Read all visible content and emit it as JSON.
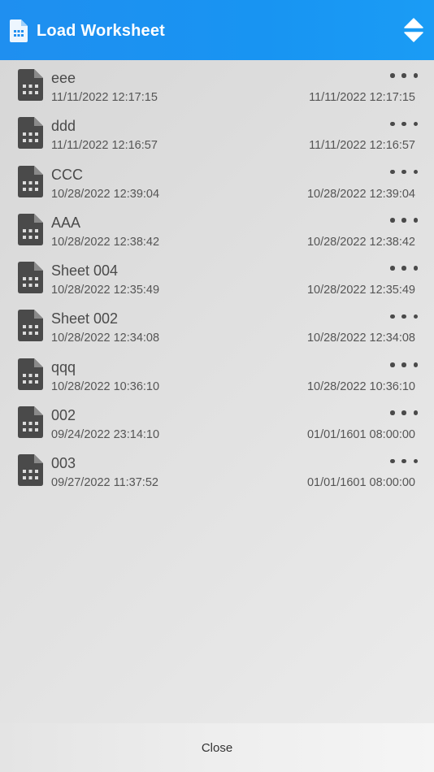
{
  "header": {
    "title": "Load Worksheet",
    "icon": "spreadsheet-file-icon",
    "sort_icon": "sort-up-down-icon"
  },
  "colors": {
    "header_bg": "#1f8ff0",
    "icon_dark": "#4a4a4a",
    "text_primary": "#4a4a4a",
    "text_secondary": "#555555"
  },
  "worksheets": [
    {
      "name": "eee",
      "created": "11/11/2022 12:17:15",
      "modified": "11/11/2022 12:17:15"
    },
    {
      "name": "ddd",
      "created": "11/11/2022 12:16:57",
      "modified": "11/11/2022 12:16:57"
    },
    {
      "name": "CCC",
      "created": "10/28/2022 12:39:04",
      "modified": "10/28/2022 12:39:04"
    },
    {
      "name": "AAA",
      "created": "10/28/2022 12:38:42",
      "modified": "10/28/2022 12:38:42"
    },
    {
      "name": "Sheet 004",
      "created": "10/28/2022 12:35:49",
      "modified": "10/28/2022 12:35:49"
    },
    {
      "name": "Sheet 002",
      "created": "10/28/2022 12:34:08",
      "modified": "10/28/2022 12:34:08"
    },
    {
      "name": "qqq",
      "created": "10/28/2022 10:36:10",
      "modified": "10/28/2022 10:36:10"
    },
    {
      "name": "002",
      "created": "09/24/2022 23:14:10",
      "modified": "01/01/1601 08:00:00"
    },
    {
      "name": "003",
      "created": "09/27/2022 11:37:52",
      "modified": "01/01/1601 08:00:00"
    }
  ],
  "footer": {
    "close_label": "Close"
  }
}
